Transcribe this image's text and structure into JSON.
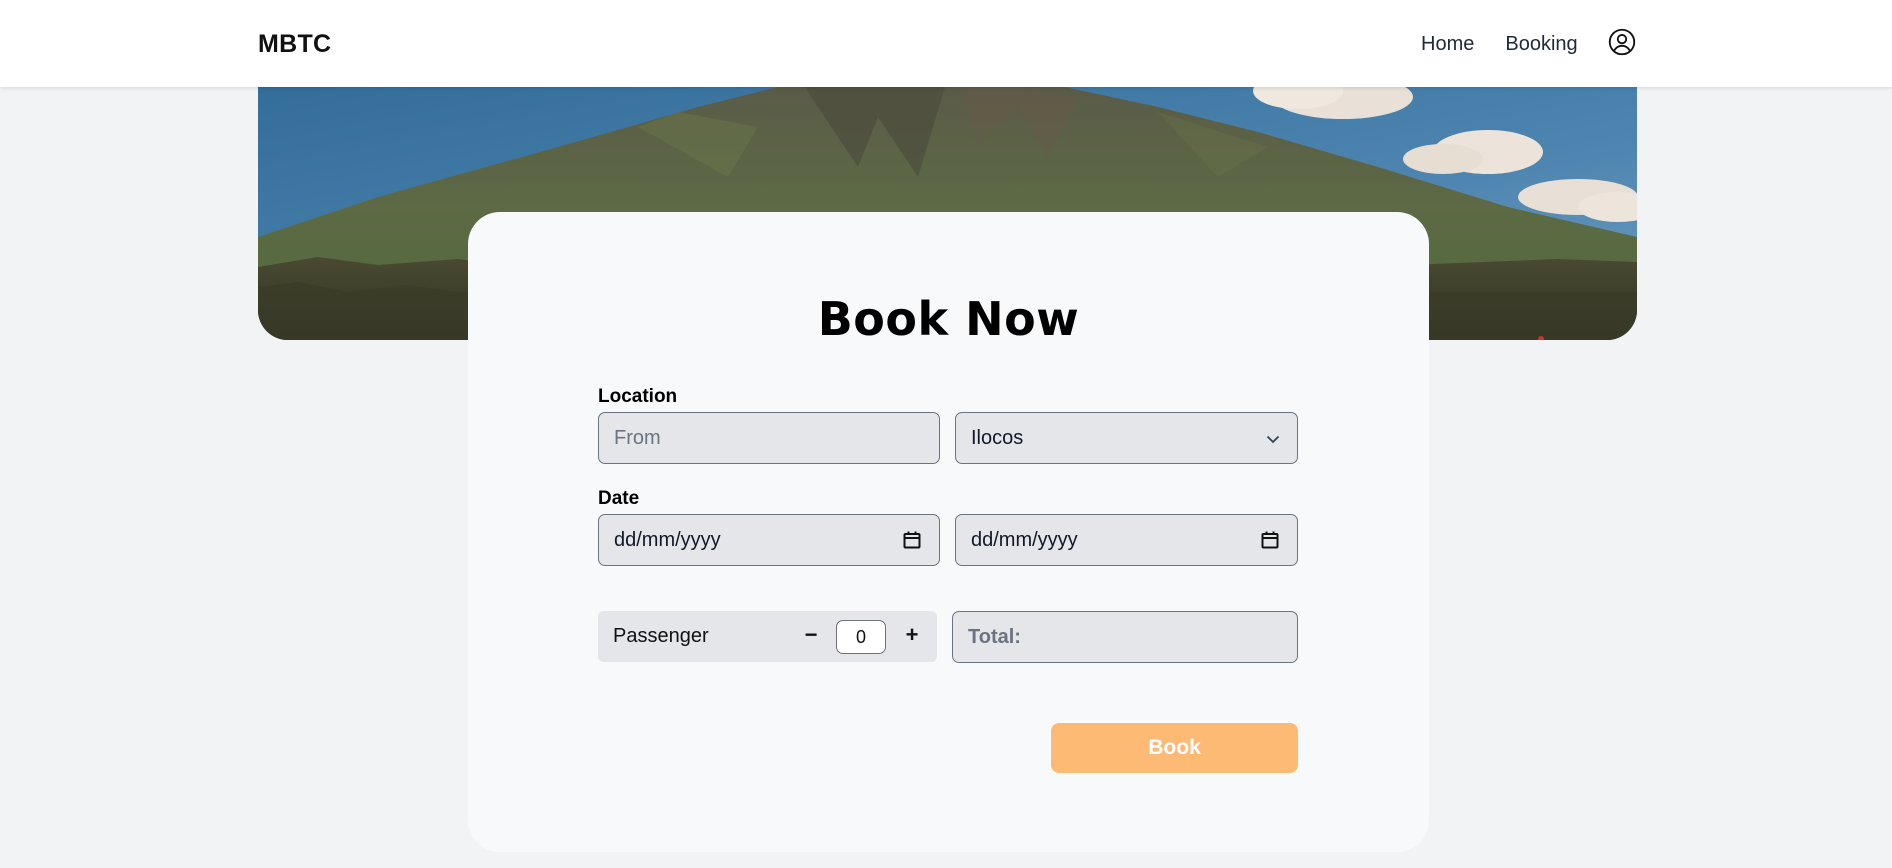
{
  "nav": {
    "brand": "MBTC",
    "links": [
      {
        "label": "Home"
      },
      {
        "label": "Booking"
      }
    ],
    "account_icon": "user-circle-icon"
  },
  "hero": {
    "image": "mountain-landscape"
  },
  "form": {
    "title": "Book Now",
    "location": {
      "label": "Location",
      "from_placeholder": "From",
      "from_value": "",
      "to_selected": "Ilocos"
    },
    "date": {
      "label": "Date",
      "start_placeholder": "dd/mm/yyyy",
      "end_placeholder": "dd/mm/yyyy"
    },
    "passenger": {
      "label": "Passenger",
      "decrement": "−",
      "increment": "+",
      "count": "0"
    },
    "total": {
      "label": "Total:"
    },
    "submit_label": "Book"
  },
  "colors": {
    "accent": "#fdba74",
    "page_bg": "#f2f3f5",
    "card_bg": "#f8f9fb",
    "input_bg": "#e5e6ea"
  }
}
